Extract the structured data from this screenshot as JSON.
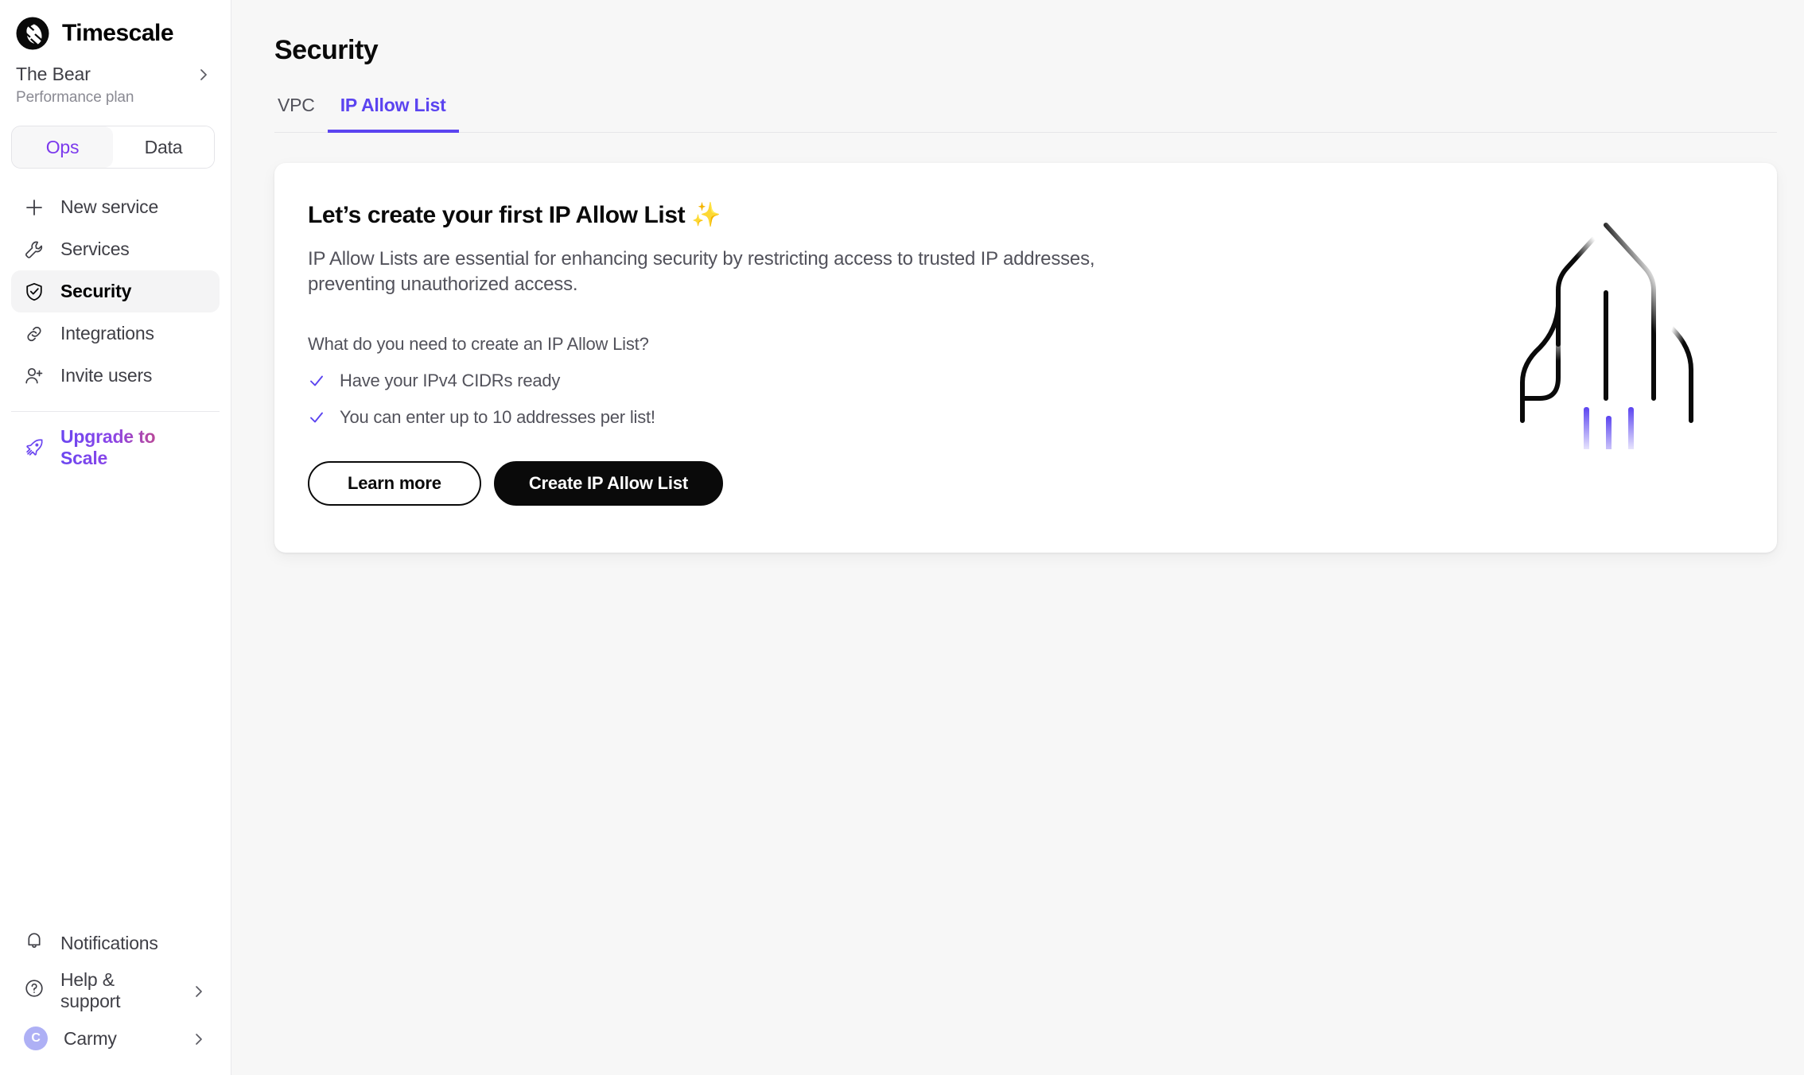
{
  "brand": {
    "name": "Timescale",
    "logo_icon": "timescale-logo-icon"
  },
  "org": {
    "name": "The Bear",
    "plan": "Performance plan",
    "chevron_icon": "chevron-right-icon"
  },
  "segmented": {
    "options": [
      {
        "label": "Ops",
        "active": true
      },
      {
        "label": "Data",
        "active": false
      }
    ]
  },
  "sidebar": {
    "items": [
      {
        "label": "New service",
        "icon": "plus-icon",
        "active": false
      },
      {
        "label": "Services",
        "icon": "wrench-icon",
        "active": false
      },
      {
        "label": "Security",
        "icon": "shield-check-icon",
        "active": true
      },
      {
        "label": "Integrations",
        "icon": "link-icon",
        "active": false
      },
      {
        "label": "Invite users",
        "icon": "user-plus-icon",
        "active": false
      }
    ],
    "upgrade": {
      "label": "Upgrade to Scale",
      "icon": "rocket-icon"
    },
    "bottom": [
      {
        "label": "Notifications",
        "icon": "bell-icon",
        "chevron": false
      },
      {
        "label": "Help & support",
        "icon": "question-circle-icon",
        "chevron": true
      },
      {
        "label": "Carmy",
        "icon": "avatar",
        "avatar_initial": "C",
        "chevron": true
      }
    ]
  },
  "main": {
    "title": "Security",
    "tabs": [
      {
        "label": "VPC",
        "active": false
      },
      {
        "label": "IP Allow List",
        "active": true
      }
    ],
    "card": {
      "title": "Let’s create your first IP Allow List ✨",
      "description": "IP Allow Lists are essential for enhancing security by restricting access to trusted IP addresses, preventing unauthorized access.",
      "question": "What do you need to create an IP Allow List?",
      "checks": [
        "Have your IPv4 CIDRs ready",
        "You can enter up to 10 addresses per list!"
      ],
      "buttons": {
        "secondary": "Learn more",
        "primary": "Create IP Allow List"
      },
      "illustration_icon": "rocket-illustration"
    }
  },
  "colors": {
    "accent_purple": "#5b44f0",
    "segment_active": "#7c3aed",
    "page_bg": "#f7f7f7",
    "sidebar_bg": "#ffffff",
    "text_primary": "#0a0a0a",
    "text_secondary": "#52525b",
    "avatar_bg": "#aeb0f5",
    "upgrade_gradient_start": "#6b46f0",
    "upgrade_gradient_end": "#e4526e"
  }
}
